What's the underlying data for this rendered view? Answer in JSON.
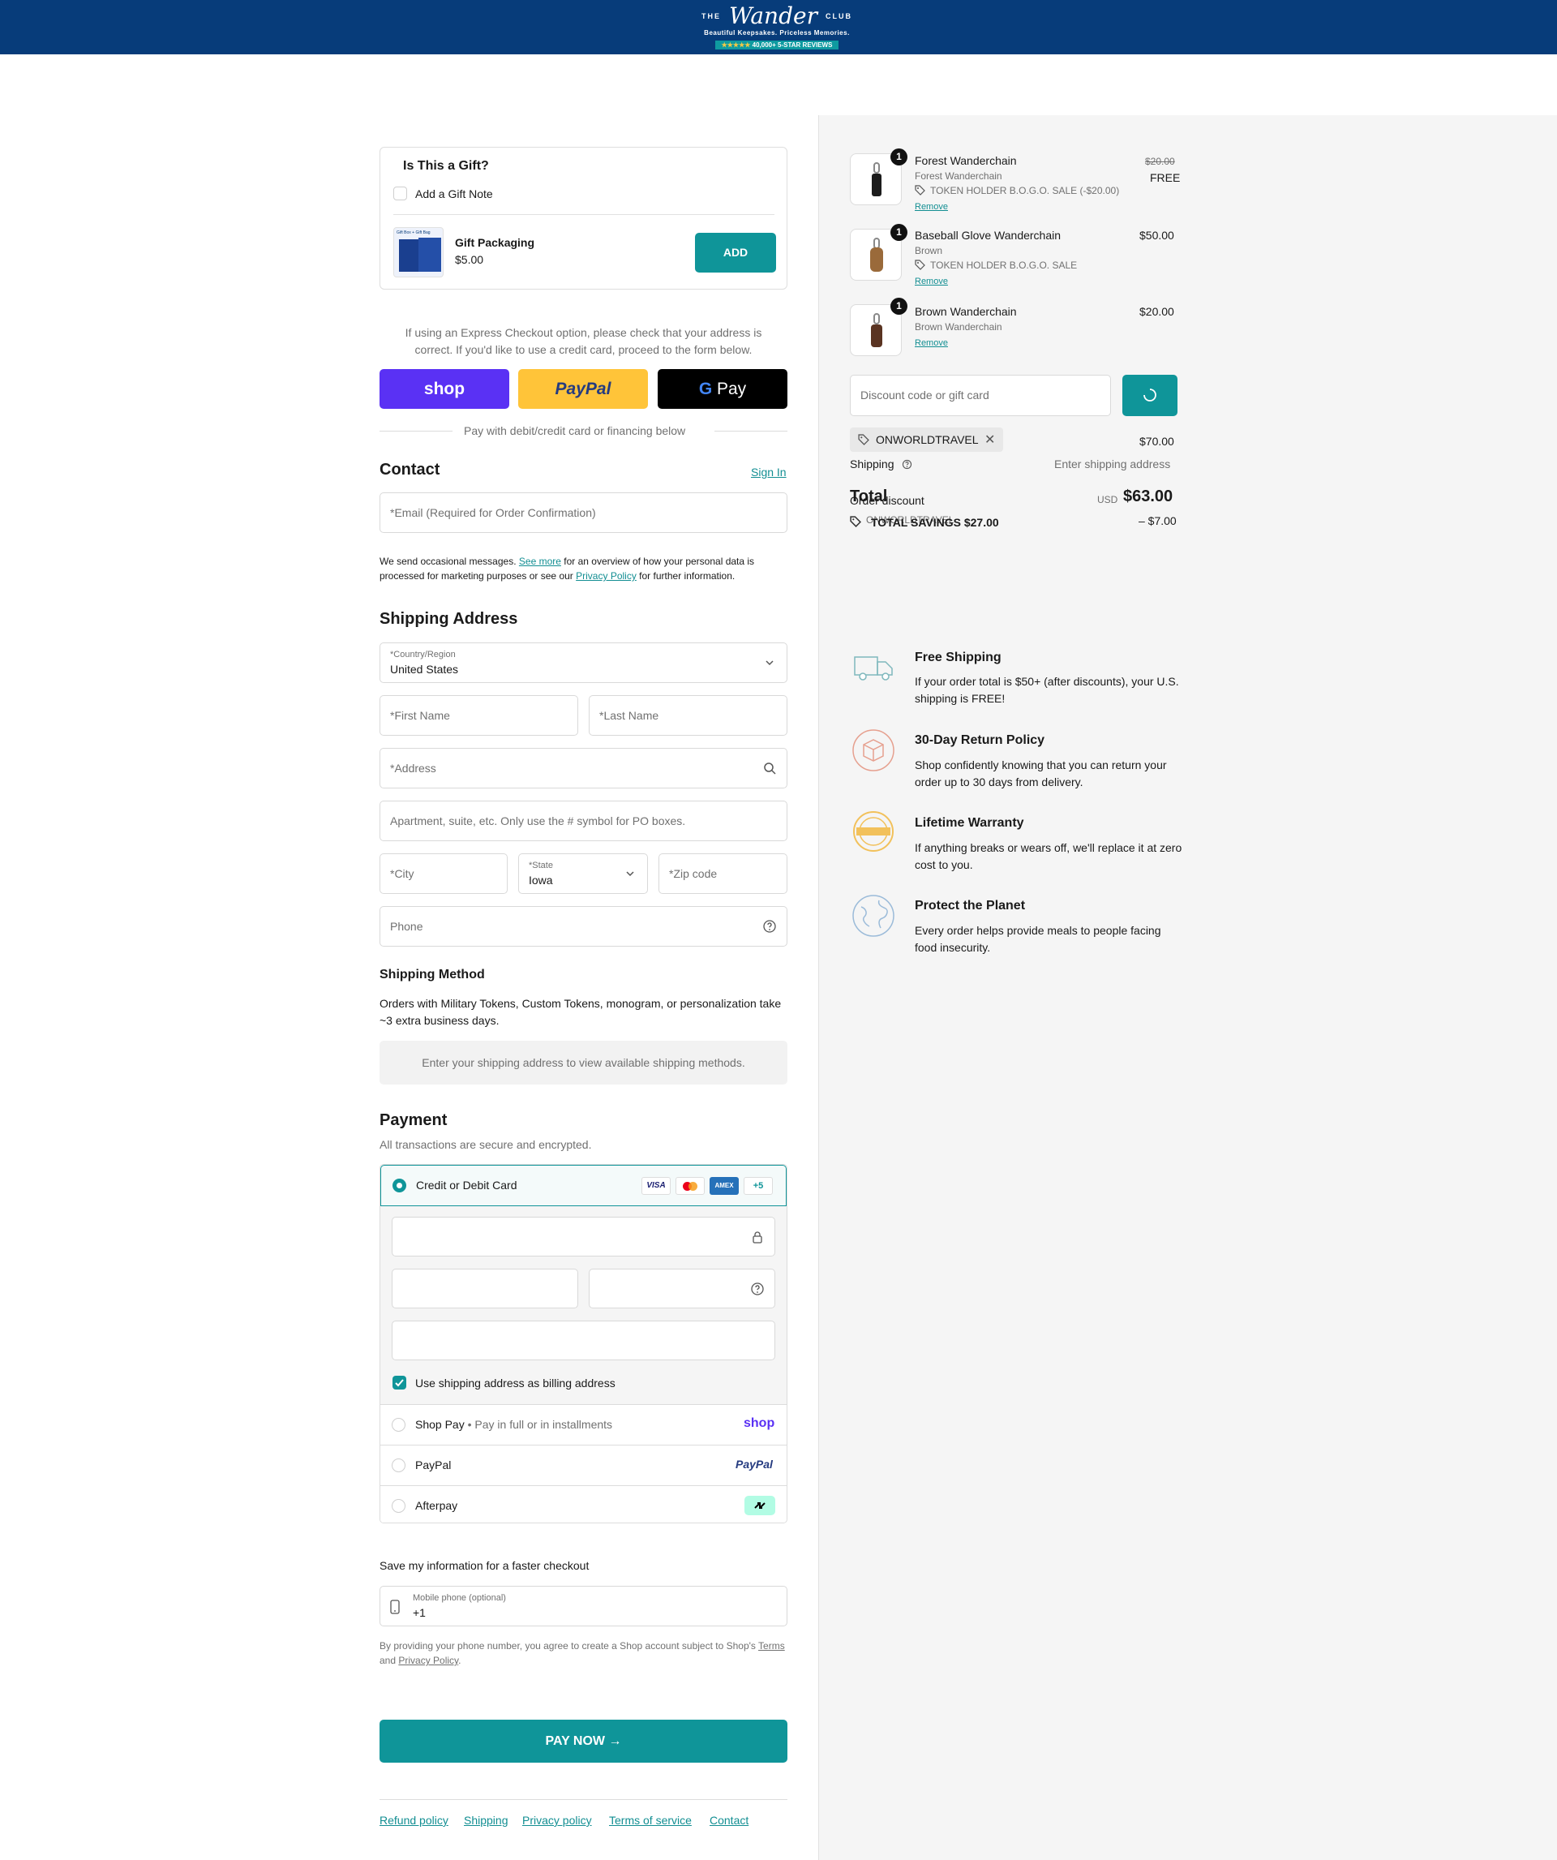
{
  "brand": {
    "the": "THE",
    "name": "Wander",
    "club": "CLUB",
    "tagline": "Beautiful Keepsakes. Priceless Memories.",
    "stars": "★★★★★",
    "reviews": "40,000+ 5-STAR REVIEWS",
    "colors": {
      "header": "#073c7a",
      "accent": "#0f9599"
    }
  },
  "gift": {
    "title": "Is This a Gift?",
    "note_label": "Add a Gift Note",
    "packaging_title": "Gift Packaging",
    "packaging_price": "$5.00",
    "add_label": "ADD",
    "box_label": "Gift Box + Gift Bag"
  },
  "express": {
    "note": "If using an Express Checkout option, please check that your address is correct. If you'd like to use a credit card, proceed to the form below.",
    "shop_label": "shop",
    "paypal_label": "PayPal",
    "gpay_label": "Pay",
    "divider": "Pay with debit/credit card or financing below"
  },
  "contact": {
    "title": "Contact",
    "sign_in": "Sign In",
    "email_placeholder": "*Email (Required for Order Confirmation)",
    "privacy_1": "We send occasional messages.",
    "see_more": "See more",
    "privacy_2": "for an overview of how your personal data is",
    "privacy_3": "processed for marketing purposes or see our",
    "privacy_policy": "Privacy Policy",
    "privacy_4": "for further information."
  },
  "shipping": {
    "title": "Shipping Address",
    "country_label": "*Country/Region",
    "country_value": "United States",
    "first_name": "*First Name",
    "last_name": "*Last Name",
    "address": "*Address",
    "apartment": "Apartment, suite, etc. Only use the # symbol for PO boxes.",
    "city": "*City",
    "state_label": "*State",
    "state_value": "Iowa",
    "zip": "*Zip code",
    "phone": "Phone"
  },
  "shipping_method": {
    "title": "Shipping Method",
    "note": "Orders with Military Tokens, Custom Tokens, monogram, or personalization take ~3 extra business days.",
    "placeholder": "Enter your shipping address to view available shipping methods."
  },
  "payment": {
    "title": "Payment",
    "subtitle": "All transactions are secure and encrypted.",
    "card_label": "Credit or Debit Card",
    "visa": "VISA",
    "amex": "AMEX",
    "more_cards": "+5",
    "billing_same": "Use shipping address as billing address",
    "shop_pay": "Shop Pay",
    "shop_pay_sub": "Pay in full or in installments",
    "shop_pay_logo": "shop",
    "paypal": "PayPal",
    "paypal_logo": "PayPal",
    "afterpay": "Afterpay"
  },
  "save_info": {
    "title": "Save my information for a faster checkout",
    "mobile_label": "Mobile phone (optional)",
    "mobile_value": "+1",
    "terms_1": "By providing your phone number, you agree to create a Shop account subject to Shop's",
    "terms_link": "Terms",
    "and": "and",
    "privacy_link": "Privacy Policy",
    "period": "."
  },
  "pay_now": "PAY NOW →",
  "footer": {
    "refund": "Refund policy",
    "shipping": "Shipping",
    "privacy": "Privacy policy",
    "terms": "Terms of service",
    "contact": "Contact"
  },
  "cart": {
    "items": [
      {
        "qty": "1",
        "name": "Forest Wanderchain",
        "variant": "Forest Wanderchain",
        "discount": "TOKEN HOLDER B.O.G.O. SALE (-$20.00)",
        "remove": "Remove",
        "orig_price": "$20.00",
        "price": "FREE"
      },
      {
        "qty": "1",
        "name": "Baseball Glove Wanderchain",
        "variant": "Brown",
        "discount": "TOKEN HOLDER B.O.G.O. SALE",
        "remove": "Remove",
        "price": "$50.00"
      },
      {
        "qty": "1",
        "name": "Brown Wanderchain",
        "variant": "Brown Wanderchain",
        "remove": "Remove",
        "price": "$20.00"
      }
    ],
    "discount_placeholder": "Discount code or gift card",
    "applied_code": "ONWORLDTRAVEL",
    "subtotal": "$70.00",
    "shipping_label": "Shipping",
    "shipping_value": "Enter shipping address",
    "order_discount": "Order discount",
    "order_discount_code": "ONWORLDTRAVEL",
    "order_discount_value": "– $7.00",
    "total_label": "Total",
    "currency": "USD",
    "total": "$63.00",
    "savings": "TOTAL SAVINGS $27.00"
  },
  "features": [
    {
      "title": "Free Shipping",
      "desc": "If your order total is $50+ (after discounts), your U.S. shipping is FREE!",
      "icon": "truck-icon"
    },
    {
      "title": "30-Day Return Policy",
      "desc": "Shop confidently knowing that you can return your order up to 30 days from delivery.",
      "icon": "return-box-icon"
    },
    {
      "title": "Lifetime Warranty",
      "desc": "If anything breaks or wears off, we'll replace it at zero cost to you.",
      "icon": "warranty-badge-icon"
    },
    {
      "title": "Protect the Planet",
      "desc": "Every order helps provide meals to people facing food insecurity.",
      "icon": "globe-icon"
    }
  ]
}
